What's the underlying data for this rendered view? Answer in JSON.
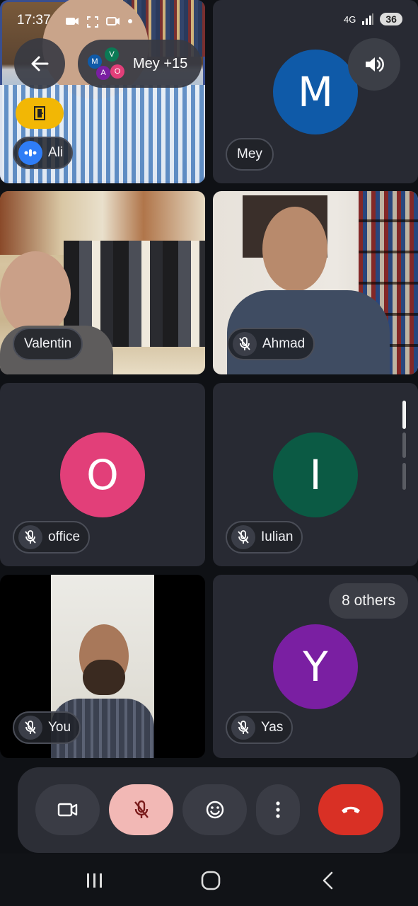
{
  "status_bar": {
    "time": "17:37",
    "network": "4G",
    "battery": "36"
  },
  "header": {
    "group_label": "Mey +15",
    "mini_avatar_letters": [
      "M",
      "V",
      "A",
      "O"
    ]
  },
  "tiles": {
    "ali": {
      "name": "Ali"
    },
    "mey": {
      "name": "Mey",
      "initial": "M",
      "color": "#0f5aa8"
    },
    "valentin": {
      "name": "Valentin"
    },
    "ahmad": {
      "name": "Ahmad"
    },
    "office": {
      "name": "office",
      "initial": "O",
      "color": "#e23f79"
    },
    "iulian": {
      "name": "Iulian",
      "initial": "I",
      "color": "#0b5a44"
    },
    "you": {
      "name": "You"
    },
    "yas": {
      "name": "Yas",
      "initial": "Y",
      "color": "#7a1fa2",
      "others_label": "8 others"
    }
  },
  "colors": {
    "end_call": "#d93025",
    "mic_off_bg": "#f2b8b5",
    "speaking": "#2f7df6",
    "room_badge": "#f2b705"
  },
  "icons": {
    "back": "arrow-left-icon",
    "speaker": "speaker-icon",
    "camera": "video-camera-icon",
    "mic_off": "mic-off-icon",
    "emoji": "emoji-icon",
    "more": "more-vert-icon",
    "end_call": "phone-hangup-icon"
  }
}
